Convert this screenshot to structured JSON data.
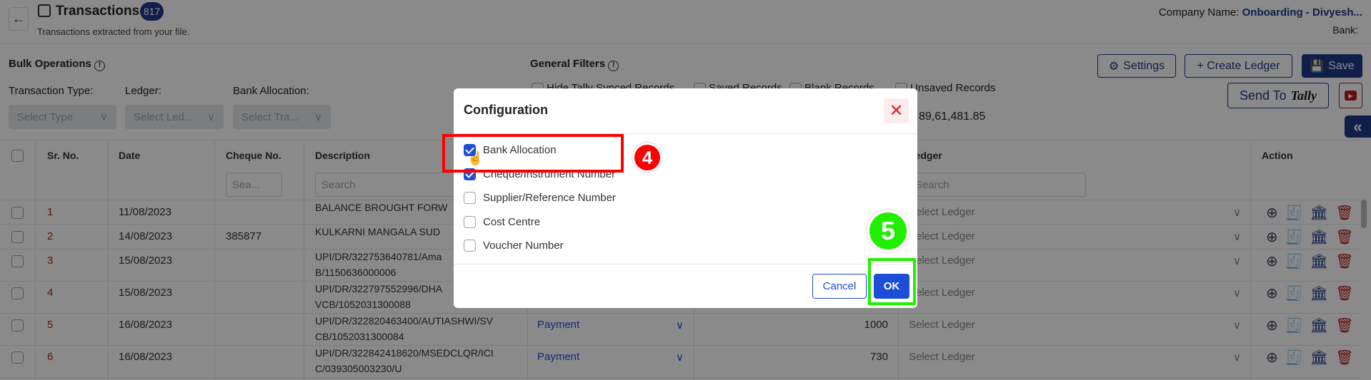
{
  "header": {
    "title": "Transactions",
    "count": "817",
    "subtitle": "Transactions extracted from your file.",
    "company_label": "Company Name:",
    "company_value": "Onboarding - Divyesh...",
    "bank_label": "Bank:"
  },
  "bulk": {
    "title": "Bulk Operations",
    "labels": [
      "Transaction Type:",
      "Ledger:",
      "Bank Allocation:"
    ],
    "selects": [
      "Select Type",
      "Select Led...",
      "Select Tra..."
    ]
  },
  "filters": {
    "title": "General Filters",
    "options": [
      "Hide Tally Synced Records",
      "Saved Records",
      "Blank Records",
      "Unsaved Records"
    ],
    "total": "89,61,481.85"
  },
  "toolbar": {
    "settings": "Settings",
    "create_ledger": "+ Create Ledger",
    "save": "Save",
    "send_to": "Send To",
    "tally": "Tally"
  },
  "table": {
    "headers": [
      "Sr. No.",
      "Date",
      "Cheque No.",
      "Description",
      "Ledger",
      "Action"
    ],
    "search_placeholder_short": "Sea...",
    "search_placeholder": "Search",
    "ledger_placeholder": "Select Ledger",
    "rows": [
      {
        "sr": "1",
        "date": "11/08/2023",
        "cheque": "",
        "desc1": "BALANCE BROUGHT FORW",
        "desc2": "",
        "type": "",
        "amount": ""
      },
      {
        "sr": "2",
        "date": "14/08/2023",
        "cheque": "385877",
        "desc1": "KULKARNI MANGALA SUD",
        "desc2": "",
        "type": "",
        "amount": ""
      },
      {
        "sr": "3",
        "date": "15/08/2023",
        "cheque": "",
        "desc1": "UPI/DR/322753640781/Ama",
        "desc2": "B/1150636000006",
        "type": "",
        "amount": ""
      },
      {
        "sr": "4",
        "date": "15/08/2023",
        "cheque": "",
        "desc1": "UPI/DR/322797552996/DHA",
        "desc2": "VCB/1052031300088",
        "type": "",
        "amount": ""
      },
      {
        "sr": "5",
        "date": "16/08/2023",
        "cheque": "",
        "desc1": "UPI/DR/322820463400/AUTIASHWI/SV",
        "desc2": "CB/1052031300084",
        "type": "Payment",
        "amount": "1000"
      },
      {
        "sr": "6",
        "date": "16/08/2023",
        "cheque": "",
        "desc1": "UPI/DR/322842418620/MSEDCLQR/ICI",
        "desc2": "C/039305003230/U",
        "type": "Payment",
        "amount": "730"
      }
    ]
  },
  "modal": {
    "title": "Configuration",
    "items": [
      {
        "label": "Bank Allocation",
        "checked": true
      },
      {
        "label": "Cheque/Instrument Number",
        "checked": true
      },
      {
        "label": "Supplier/Reference Number",
        "checked": false
      },
      {
        "label": "Cost Centre",
        "checked": false
      },
      {
        "label": "Voucher Number",
        "checked": false
      }
    ],
    "cancel": "Cancel",
    "ok": "OK"
  },
  "annotations": {
    "step4": "4",
    "step5": "5"
  },
  "colors": {
    "primary": "#1e3a8a",
    "accent": "#1d4ed8",
    "danger": "#b91c1c",
    "highlight_red": "#ff0000",
    "highlight_green": "#22ee00"
  }
}
